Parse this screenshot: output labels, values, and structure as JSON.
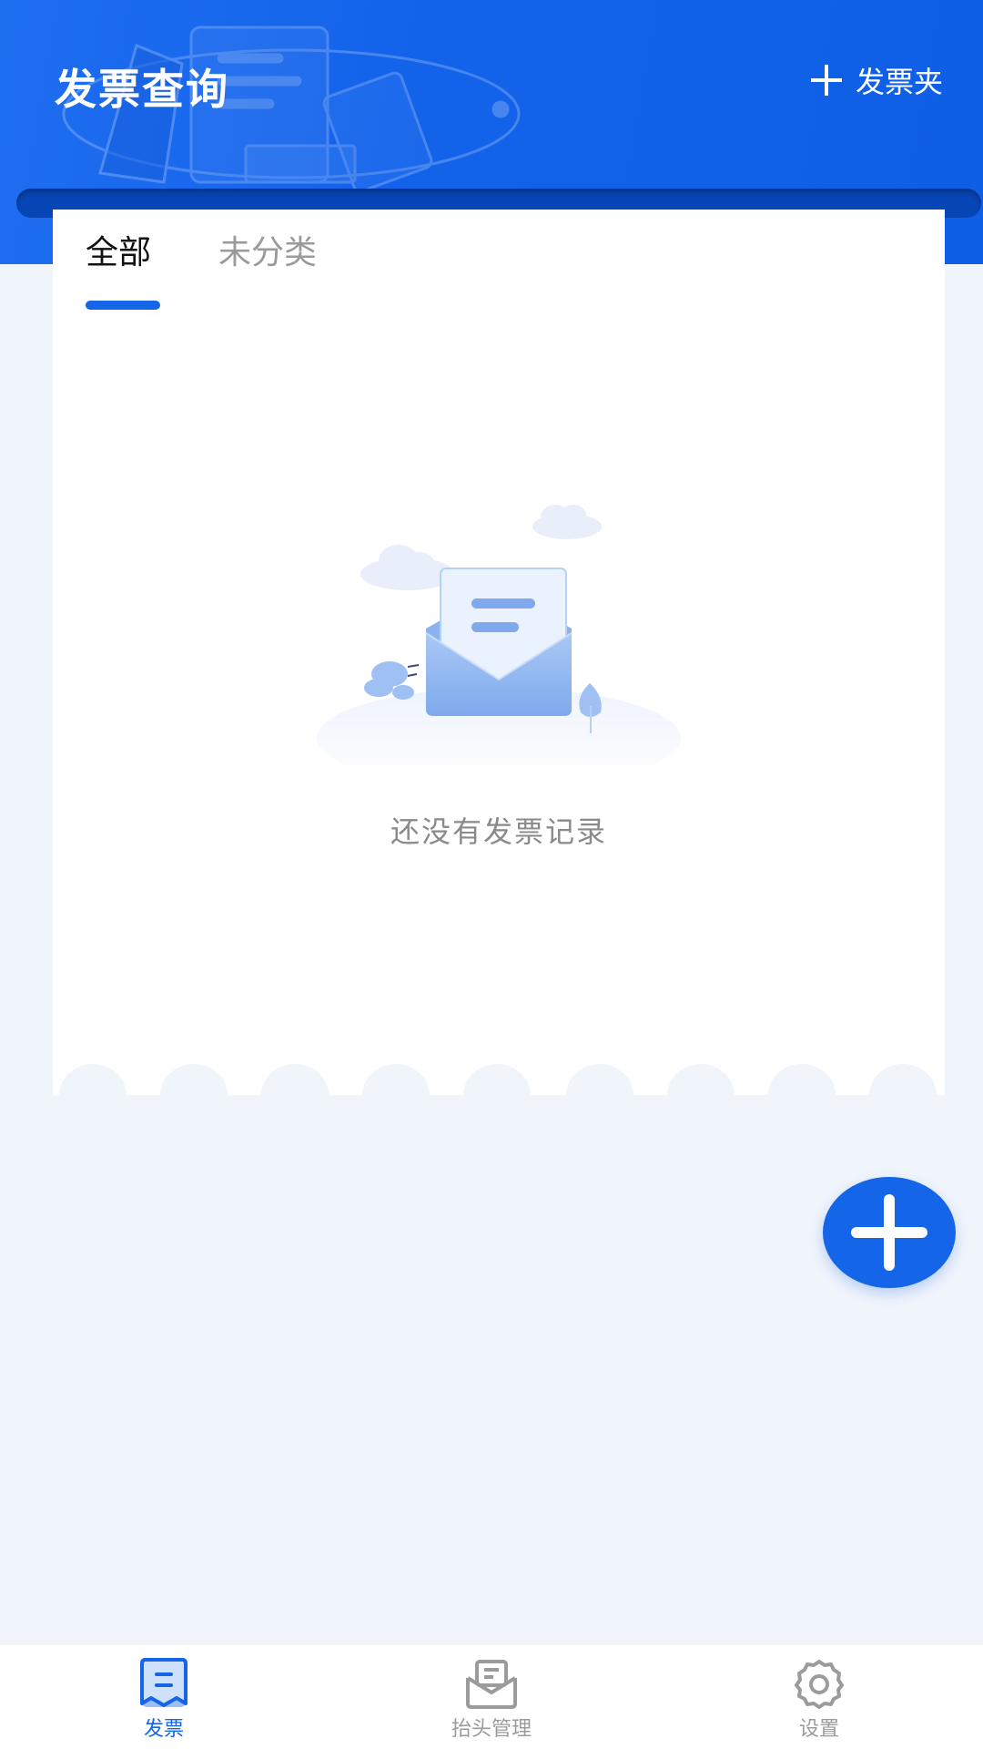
{
  "header": {
    "title": "发票查询",
    "folder_button_label": "发票夹",
    "folder_button_icon": "plus-icon"
  },
  "tabs": [
    {
      "label": "全部",
      "active": true
    },
    {
      "label": "未分类",
      "active": false
    }
  ],
  "empty_state": {
    "icon": "envelope-letter-illustration",
    "message": "还没有发票记录"
  },
  "fab": {
    "icon": "plus-icon"
  },
  "bottom_nav": [
    {
      "label": "发票",
      "icon": "invoice-icon",
      "active": true
    },
    {
      "label": "抬头管理",
      "icon": "inbox-letter-icon",
      "active": false
    },
    {
      "label": "设置",
      "icon": "gear-icon",
      "active": false
    }
  ],
  "colors": {
    "primary": "#1565e8",
    "header_dark": "#0746b6",
    "background": "#f0f4fb",
    "inactive": "#9b9b9b"
  }
}
